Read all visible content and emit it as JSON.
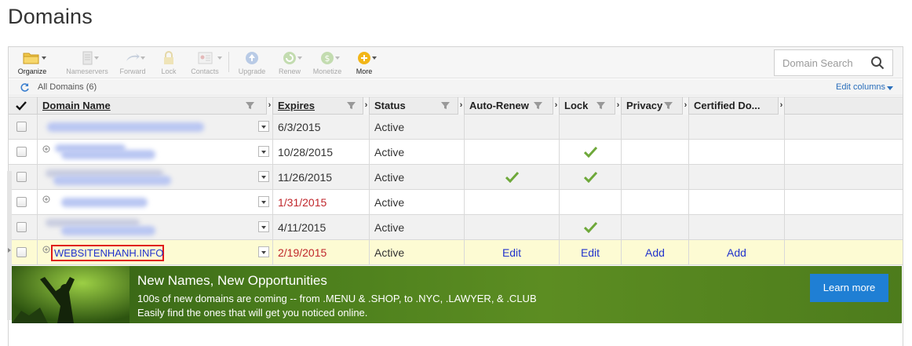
{
  "page": {
    "title": "Domains"
  },
  "toolbar": {
    "items": [
      {
        "id": "organize",
        "label": "Organize",
        "icon": "folder-icon",
        "enabled": true
      },
      {
        "id": "nameservers",
        "label": "Nameservers",
        "icon": "server-icon",
        "enabled": false
      },
      {
        "id": "forward",
        "label": "Forward",
        "icon": "forward-icon",
        "enabled": false
      },
      {
        "id": "lock",
        "label": "Lock",
        "icon": "lock-icon",
        "enabled": false
      },
      {
        "id": "contacts",
        "label": "Contacts",
        "icon": "contacts-icon",
        "enabled": false
      },
      {
        "id": "upgrade",
        "label": "Upgrade",
        "icon": "upgrade-icon",
        "enabled": false
      },
      {
        "id": "renew",
        "label": "Renew",
        "icon": "renew-icon",
        "enabled": false
      },
      {
        "id": "monetize",
        "label": "Monetize",
        "icon": "monetize-icon",
        "enabled": false
      },
      {
        "id": "more",
        "label": "More",
        "icon": "more-icon",
        "enabled": true
      }
    ],
    "search_placeholder": "Domain Search"
  },
  "infobar": {
    "all_domains": "All Domains (6)",
    "edit_columns": "Edit columns"
  },
  "table": {
    "headers": {
      "domain": "Domain Name",
      "expires": "Expires",
      "status": "Status",
      "auto_renew": "Auto-Renew",
      "lock": "Lock",
      "privacy": "Privacy",
      "certified": "Certified Do..."
    },
    "rows": [
      {
        "expires": "6/3/2015",
        "expired": false,
        "status": "Active",
        "auto_renew": "",
        "lock": "",
        "privacy": "",
        "certified": ""
      },
      {
        "expires": "10/28/2015",
        "expired": false,
        "status": "Active",
        "auto_renew": "",
        "lock": "check",
        "privacy": "",
        "certified": ""
      },
      {
        "expires": "11/26/2015",
        "expired": false,
        "status": "Active",
        "auto_renew": "check",
        "lock": "check",
        "privacy": "",
        "certified": ""
      },
      {
        "expires": "1/31/2015",
        "expired": true,
        "status": "Active",
        "auto_renew": "",
        "lock": "",
        "privacy": "",
        "certified": ""
      },
      {
        "expires": "4/11/2015",
        "expired": false,
        "status": "Active",
        "auto_renew": "",
        "lock": "check",
        "privacy": "",
        "certified": ""
      },
      {
        "domain": "WEBSITENHANH.INFO",
        "expires": "2/19/2015",
        "expired": true,
        "status": "Active",
        "auto_renew": "Edit",
        "lock": "Edit",
        "privacy": "Add",
        "certified": "Add"
      }
    ]
  },
  "banner": {
    "title": "New Names, New Opportunities",
    "line1": "100s of new domains are coming -- from .MENU & .SHOP, to .NYC, .LAWYER, & .CLUB",
    "line2": "Easily find the ones that will get you noticed online.",
    "button": "Learn more"
  },
  "colors": {
    "link": "#2233cc",
    "expired": "#c0262b",
    "selected_row": "#fdfbd3",
    "check": "#6ea83a",
    "banner_button": "#1f7fd4"
  }
}
